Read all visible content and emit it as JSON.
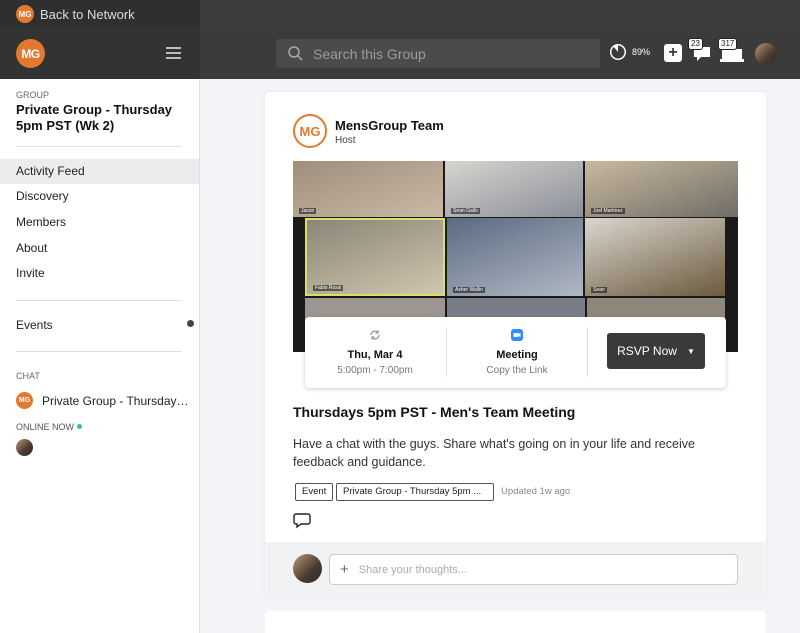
{
  "topbar": {
    "back_label": "Back to Network"
  },
  "header": {
    "logo_text": "MG",
    "search_placeholder": "Search this Group",
    "progress": {
      "value": 0.89,
      "label": "89%"
    },
    "plus_label": "+",
    "messages_count": "23",
    "notifications_count": "317"
  },
  "sidebar": {
    "group_label": "GROUP",
    "group_title": "Private Group - Thursday 5pm PST (Wk 2)",
    "nav": [
      {
        "label": "Activity Feed",
        "active": true
      },
      {
        "label": "Discovery",
        "active": false
      },
      {
        "label": "Members",
        "active": false
      },
      {
        "label": "About",
        "active": false
      },
      {
        "label": "Invite",
        "active": false
      }
    ],
    "events_label": "Events",
    "chat_label": "CHAT",
    "chat_item": "Private Group - Thursday…",
    "online_label": "ONLINE NOW"
  },
  "post": {
    "host_logo_text": "MG",
    "host_name": "MensGroup Team",
    "host_role": "Host",
    "participants": [
      "Jason",
      "Sean Gallo",
      "Joel Martinez",
      "Fabio Rossi",
      "Asher Wallin",
      "Sean"
    ],
    "event": {
      "date": "Thu, Mar 4",
      "time": "5:00pm - 7:00pm",
      "type": "Meeting",
      "link_label": "Copy the Link",
      "rsvp_label": "RSVP Now"
    },
    "title": "Thursdays 5pm PST - Men's Team Meeting",
    "description": "Have a chat with the guys. Share what's going on in your life and receive feedback and guidance.",
    "tags": [
      "Event",
      "Private Group - Thursday 5pm ..."
    ],
    "updated": "Updated 1w ago",
    "reply_placeholder": "Share your thoughts..."
  },
  "colors": {
    "brand": "#e2792f",
    "online": "#2ecc71",
    "dark": "#3b3b3b"
  }
}
